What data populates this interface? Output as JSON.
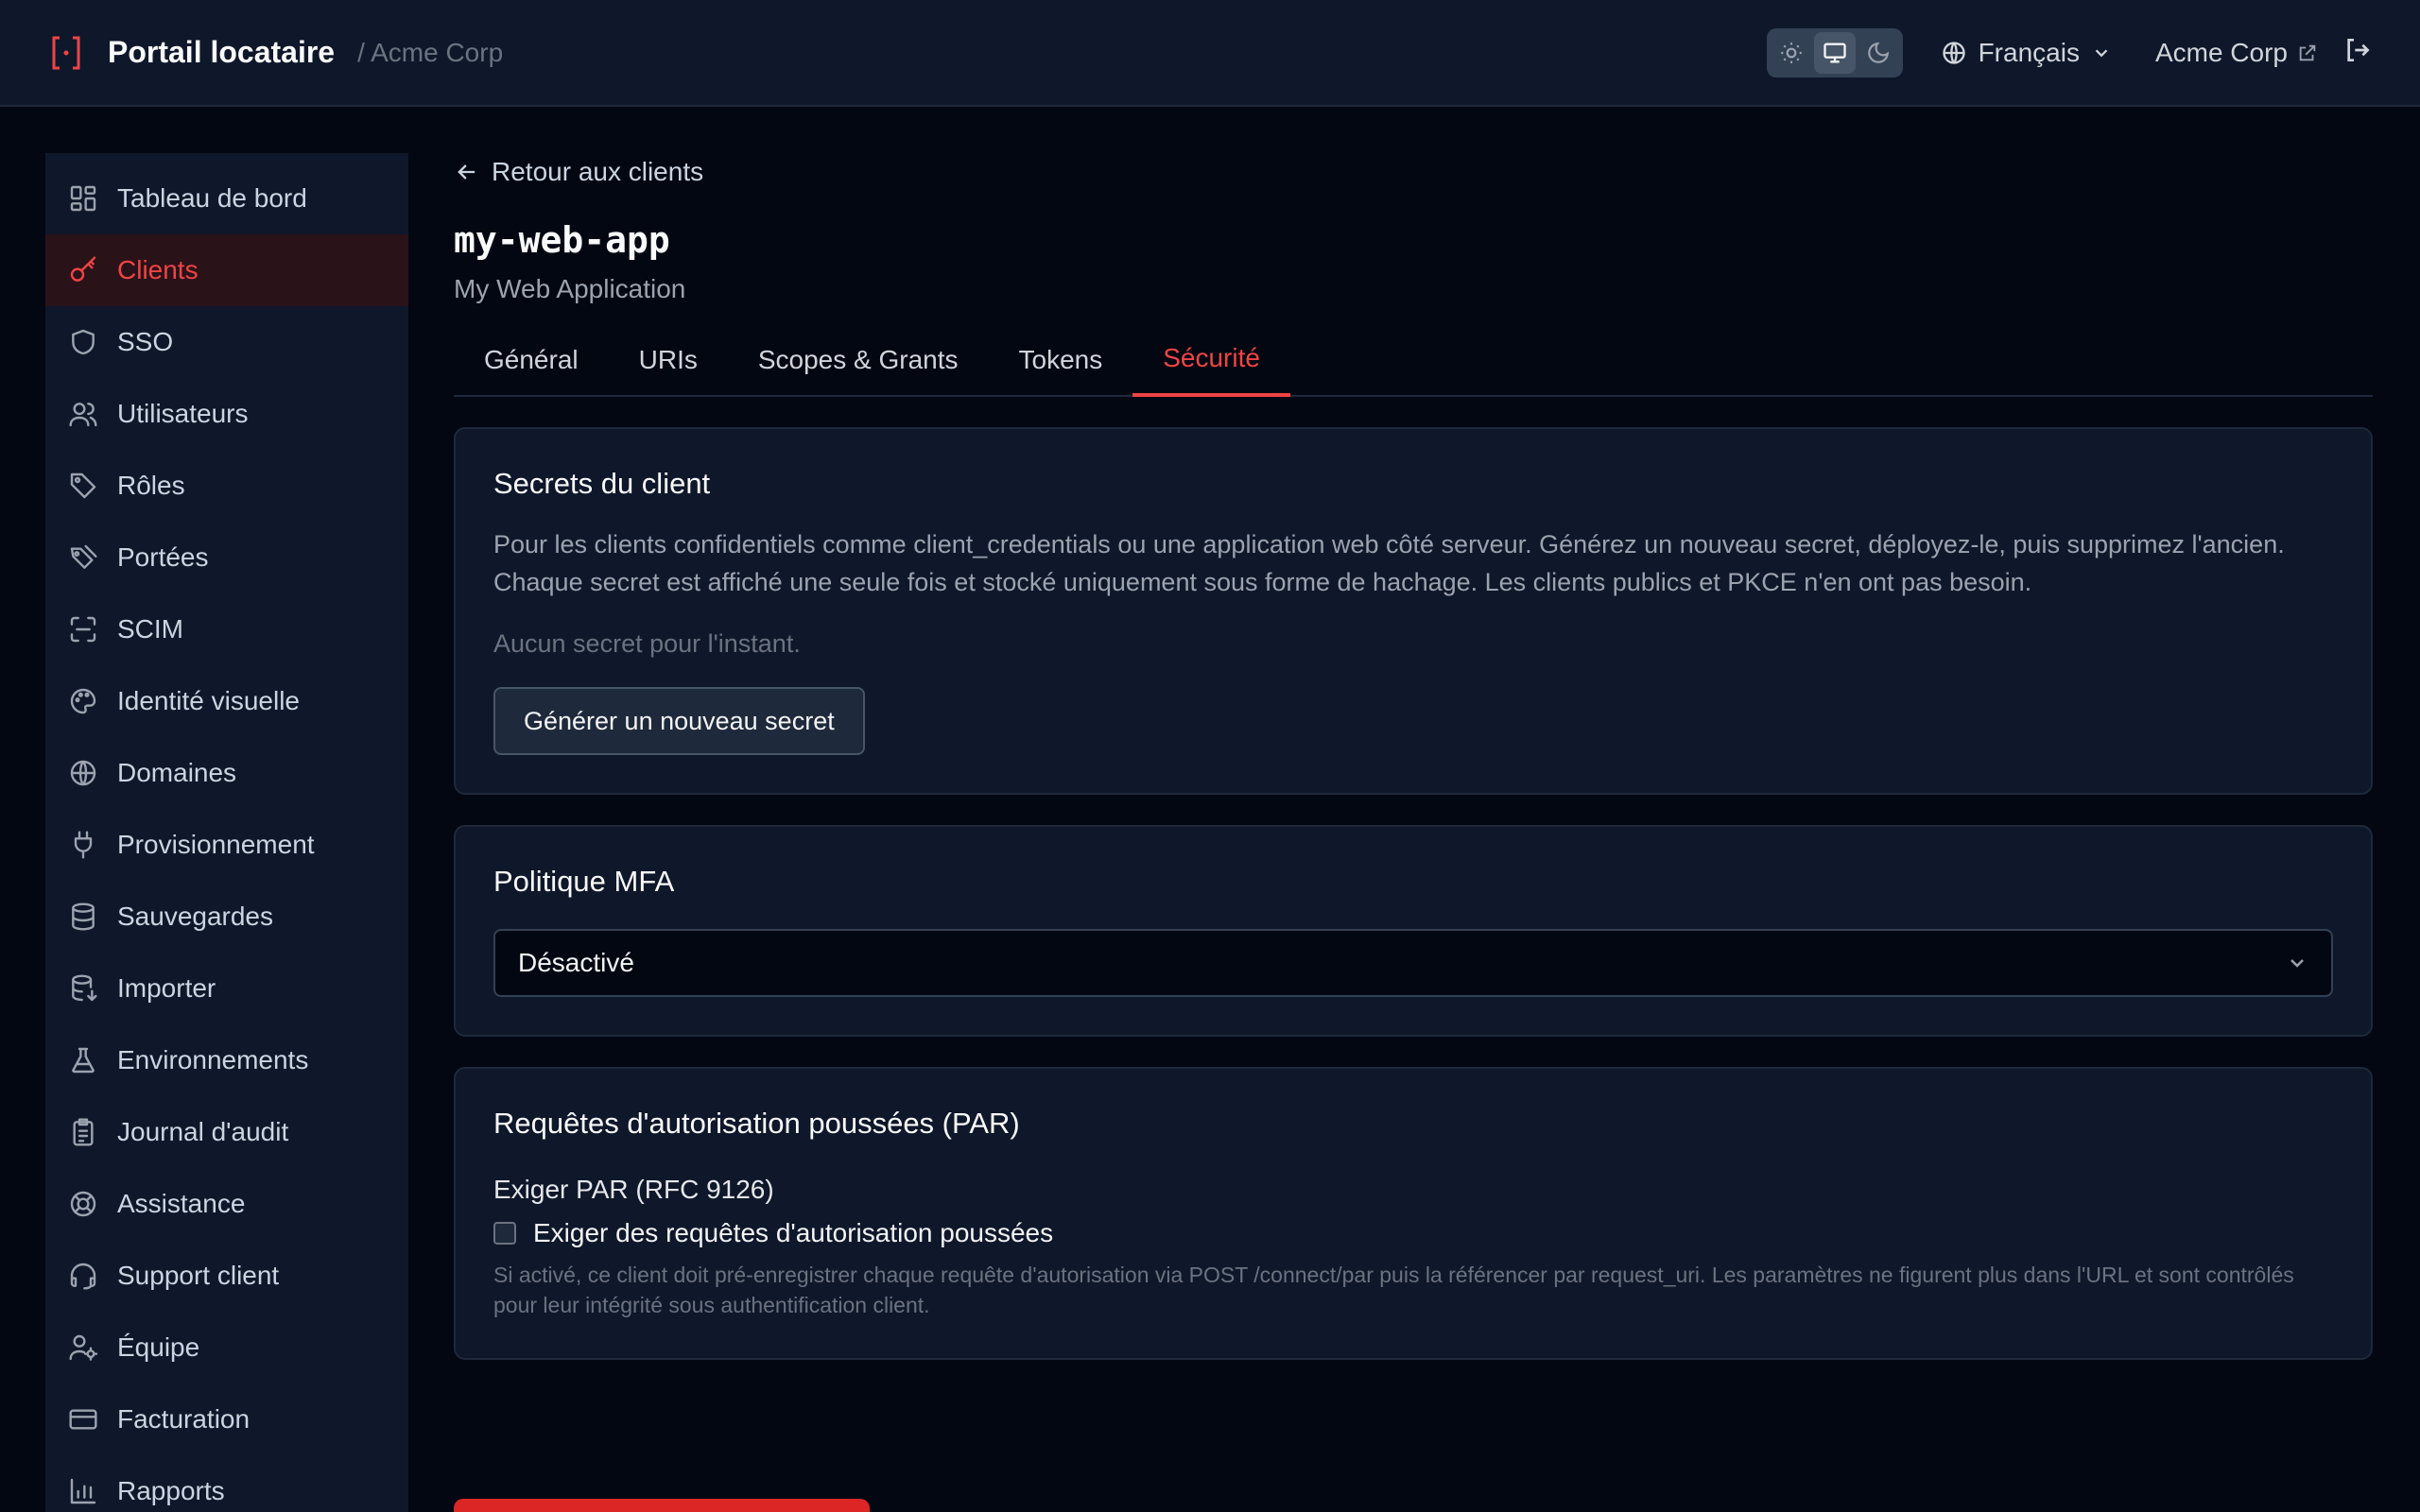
{
  "header": {
    "app_title": "Portail locataire",
    "breadcrumb": "/ Acme Corp",
    "language": "Français",
    "tenant_link": "Acme Corp",
    "accent": "#ef4444"
  },
  "sidebar": {
    "items": [
      {
        "label": "Tableau de bord",
        "icon": "dashboard-icon"
      },
      {
        "label": "Clients",
        "icon": "key-icon",
        "active": true
      },
      {
        "label": "SSO",
        "icon": "shield-icon"
      },
      {
        "label": "Utilisateurs",
        "icon": "users-icon"
      },
      {
        "label": "Rôles",
        "icon": "tag-icon"
      },
      {
        "label": "Portées",
        "icon": "tags-icon"
      },
      {
        "label": "SCIM",
        "icon": "scan-icon"
      },
      {
        "label": "Identité visuelle",
        "icon": "palette-icon"
      },
      {
        "label": "Domaines",
        "icon": "globe-icon"
      },
      {
        "label": "Provisionnement",
        "icon": "plug-icon"
      },
      {
        "label": "Sauvegardes",
        "icon": "database-icon"
      },
      {
        "label": "Importer",
        "icon": "database-import-icon"
      },
      {
        "label": "Environnements",
        "icon": "flask-icon"
      },
      {
        "label": "Journal d'audit",
        "icon": "clipboard-icon"
      },
      {
        "label": "Assistance",
        "icon": "lifebuoy-icon"
      },
      {
        "label": "Support client",
        "icon": "headset-icon"
      },
      {
        "label": "Équipe",
        "icon": "user-cog-icon"
      },
      {
        "label": "Facturation",
        "icon": "credit-card-icon"
      },
      {
        "label": "Rapports",
        "icon": "bar-chart-icon"
      }
    ]
  },
  "main": {
    "back_label": "Retour aux clients",
    "client_id": "my-web-app",
    "client_name": "My Web Application",
    "tabs": [
      {
        "label": "Général"
      },
      {
        "label": "URIs"
      },
      {
        "label": "Scopes & Grants"
      },
      {
        "label": "Tokens"
      },
      {
        "label": "Sécurité",
        "active": true
      }
    ],
    "secrets": {
      "title": "Secrets du client",
      "description": "Pour les clients confidentiels comme client_credentials ou une application web côté serveur. Générez un nouveau secret, déployez-le, puis supprimez l'ancien. Chaque secret est affiché une seule fois et stocké uniquement sous forme de hachage. Les clients publics et PKCE n'en ont pas besoin.",
      "empty": "Aucun secret pour l'instant.",
      "generate_label": "Générer un nouveau secret"
    },
    "mfa": {
      "title": "Politique MFA",
      "selected": "Désactivé"
    },
    "par": {
      "title": "Requêtes d'autorisation poussées (PAR)",
      "field_label": "Exiger PAR (RFC 9126)",
      "checkbox_label": "Exiger des requêtes d'autorisation poussées",
      "checked": false,
      "hint": "Si activé, ce client doit pré-enregistrer chaque requête d'autorisation via POST /connect/par puis la référencer par request_uri. Les paramètres ne figurent plus dans l'URL et sont contrôlés pour leur intégrité sous authentification client."
    }
  }
}
